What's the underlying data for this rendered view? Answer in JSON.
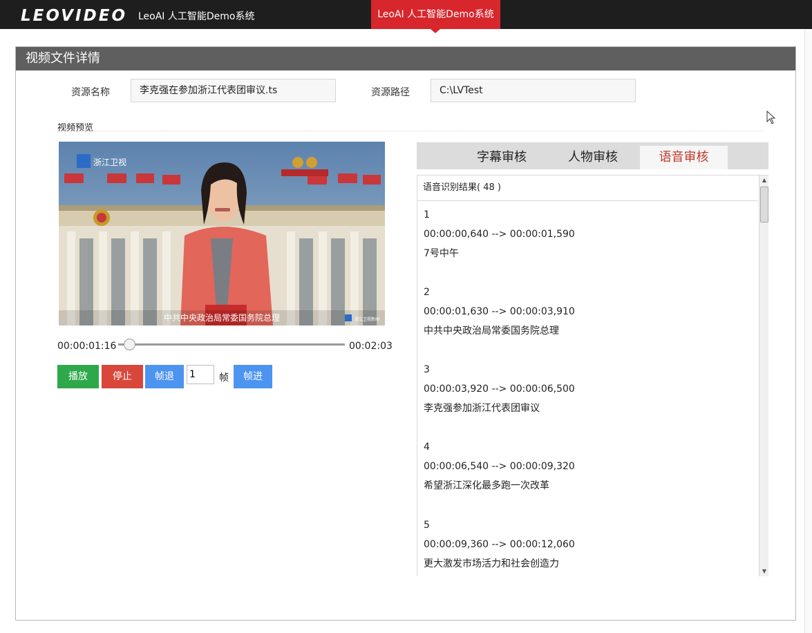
{
  "topbar": {
    "logo_text": "LEOVIDEO",
    "system_title": "LeoAI 人工智能Demo系统",
    "active_tab": "LeoAI 人工智能Demo系统"
  },
  "panel": {
    "title": "视频文件详情",
    "resource_name_label": "资源名称",
    "resource_name_value": "李克强在参加浙江代表团审议.ts",
    "resource_path_label": "资源路径",
    "resource_path_value": "C:\\LVTest",
    "preview_title": "视频预览"
  },
  "video": {
    "channel_logo": "浙江卫视",
    "subtitle": "中共中央政治局常委国务院总理",
    "watermark": "浙江卫视新闻",
    "current_time": "00:00:01:16",
    "total_time": "00:02:03",
    "progress": 0.05
  },
  "controls": {
    "play": "播放",
    "stop": "停止",
    "step_back": "帧退",
    "frame_count": "1",
    "frame_unit": "帧",
    "step_forward": "帧进"
  },
  "review_tabs": {
    "subtitle_review": "字幕审核",
    "person_review": "人物审核",
    "speech_review": "语音审核",
    "active": "speech_review"
  },
  "results": {
    "header": "语音识别结果( 48 )",
    "entries": [
      {
        "index": "1",
        "time": "00:00:00,640 --> 00:00:01,590",
        "text": "7号中午"
      },
      {
        "index": "2",
        "time": "00:00:01,630 --> 00:00:03,910",
        "text": "中共中央政治局常委国务院总理"
      },
      {
        "index": "3",
        "time": "00:00:03,920 --> 00:00:06,500",
        "text": "李克强参加浙江代表团审议"
      },
      {
        "index": "4",
        "time": "00:00:06,540 --> 00:00:09,320",
        "text": "希望浙江深化最多跑一次改革"
      },
      {
        "index": "5",
        "time": "00:00:09,360 --> 00:00:12,060",
        "text": "更大激发市场活力和社会创造力"
      }
    ]
  },
  "colors": {
    "topbar": "#1e1e1e",
    "active_tab": "#d7262c",
    "panel_header": "#5f5f5f",
    "play": "#2ea84a",
    "stop": "#d9463a",
    "step": "#4d94f1",
    "active_review_tab_text": "#c0392b"
  }
}
